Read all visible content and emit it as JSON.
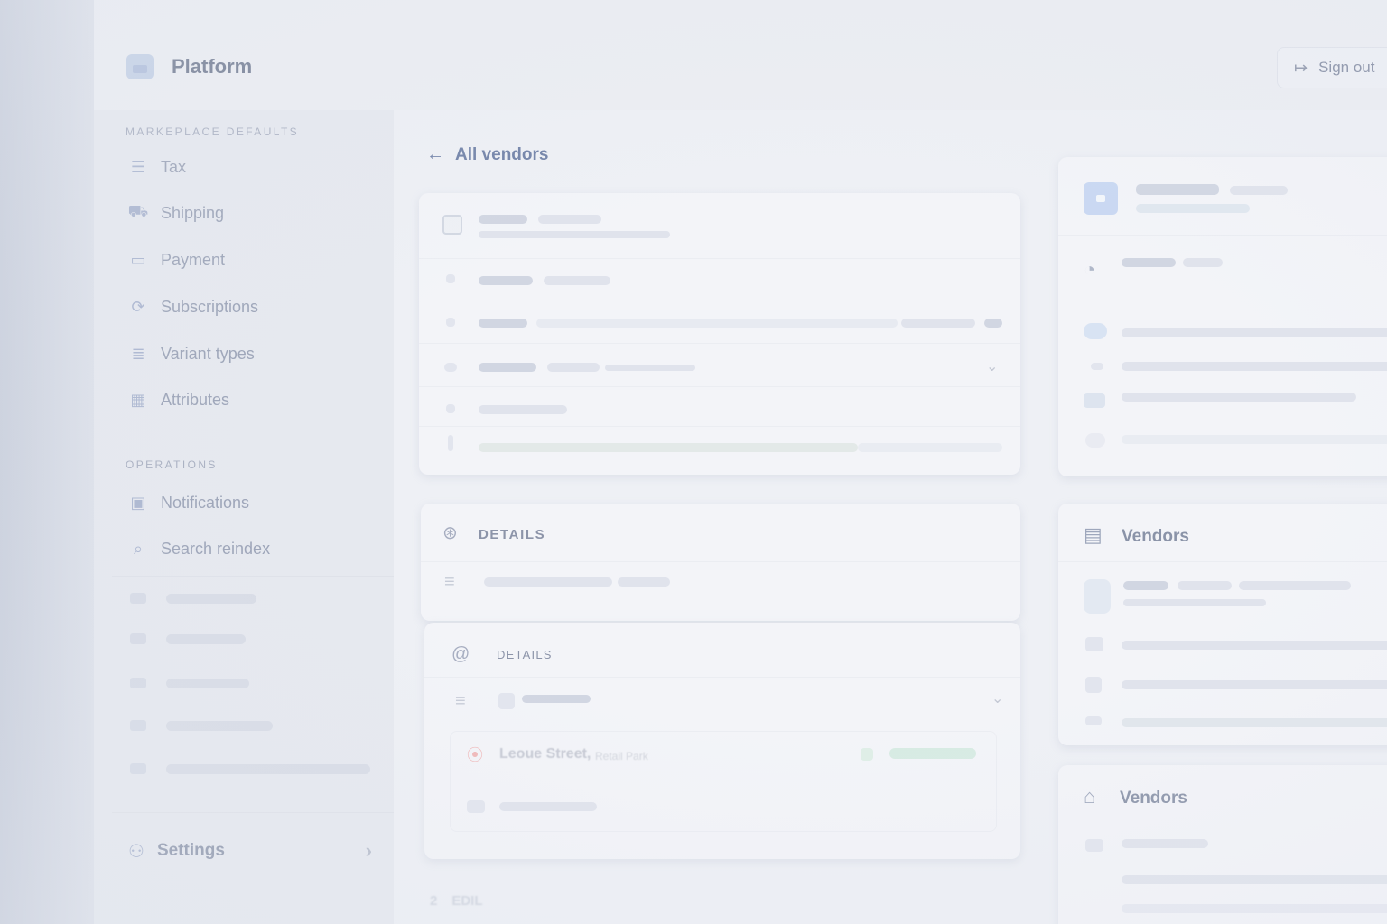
{
  "app": {
    "brand": "Platform",
    "sign_out": "Sign out"
  },
  "sidebar": {
    "section_marketplace": "MARKEPLACE DEFAULTS",
    "items_marketplace": [
      {
        "label": "Tax",
        "icon": "lines-icon"
      },
      {
        "label": "Shipping",
        "icon": "truck-icon"
      },
      {
        "label": "Payment",
        "icon": "wallet-icon"
      },
      {
        "label": "Subscriptions",
        "icon": "repeat-icon"
      },
      {
        "label": "Variant types",
        "icon": "list-icon"
      },
      {
        "label": "Attributes",
        "icon": "grid-icon"
      }
    ],
    "section_operations": "OPERATIONS",
    "items_operations": [
      {
        "label": "Notifications",
        "icon": "bell-box-icon"
      },
      {
        "label": "Search reindex",
        "icon": "search-icon"
      }
    ],
    "settings": "Settings"
  },
  "main": {
    "back_label": "All vendors",
    "details_label": "DETAILS",
    "details_label_2": "DETAILS",
    "location_street": "Leoue Street,",
    "location_sub": "Retail Park",
    "edit_label": "EDIL"
  },
  "right": {
    "vendors_title_1": "Vendors",
    "vendors_title_2": "Vendors"
  }
}
